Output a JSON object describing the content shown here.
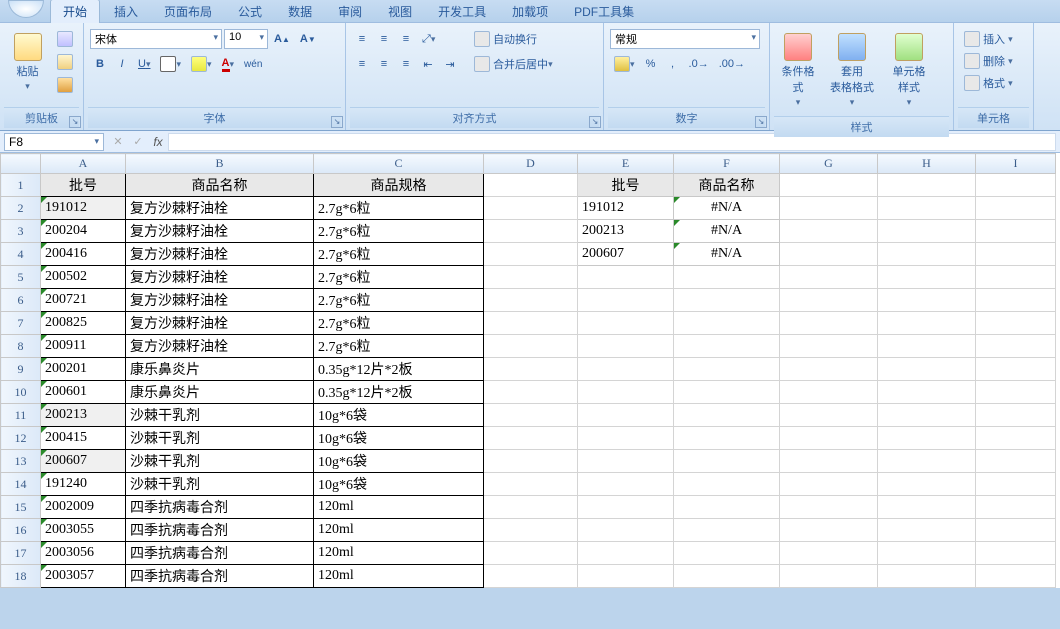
{
  "tabs": [
    "开始",
    "插入",
    "页面布局",
    "公式",
    "数据",
    "审阅",
    "视图",
    "开发工具",
    "加载项",
    "PDF工具集"
  ],
  "activeTabIndex": 0,
  "clipboard": {
    "label": "剪贴板",
    "paste": "粘贴"
  },
  "font": {
    "label": "字体",
    "family": "宋体",
    "size": "10",
    "bold": "B",
    "italic": "I",
    "underline": "U"
  },
  "alignment": {
    "label": "对齐方式",
    "wrap": "自动换行",
    "merge": "合并后居中"
  },
  "number": {
    "label": "数字",
    "format": "常规",
    "pct": "%",
    "comma": ","
  },
  "styles": {
    "label": "样式",
    "cond": "条件格式",
    "table": "套用\n表格格式",
    "cell": "单元格\n样式"
  },
  "cells": {
    "label": "单元格",
    "insert": "插入",
    "delete": "删除",
    "format": "格式"
  },
  "namebox": "F8",
  "cols": [
    "A",
    "B",
    "C",
    "D",
    "E",
    "F",
    "G",
    "H",
    "I"
  ],
  "leftHeaders": [
    "批号",
    "商品名称",
    "商品规格"
  ],
  "rightHeaders": [
    "批号",
    "商品名称"
  ],
  "rows": [
    {
      "n": 1,
      "A": "批号",
      "B": "商品名称",
      "C": "商品规格",
      "E": "批号",
      "F": "商品名称",
      "hdr": true,
      "rhdr": true
    },
    {
      "n": 2,
      "A": "191012",
      "B": "复方沙棘籽油栓",
      "C": "2.7g*6粒",
      "E": "191012",
      "F": "#N/A",
      "shadeA": true,
      "errF": true
    },
    {
      "n": 3,
      "A": "200204",
      "B": "复方沙棘籽油栓",
      "C": "2.7g*6粒",
      "E": "200213",
      "F": "#N/A",
      "errF": true
    },
    {
      "n": 4,
      "A": "200416",
      "B": "复方沙棘籽油栓",
      "C": "2.7g*6粒",
      "E": "200607",
      "F": "#N/A",
      "errF": true
    },
    {
      "n": 5,
      "A": "200502",
      "B": "复方沙棘籽油栓",
      "C": "2.7g*6粒"
    },
    {
      "n": 6,
      "A": "200721",
      "B": "复方沙棘籽油栓",
      "C": "2.7g*6粒"
    },
    {
      "n": 7,
      "A": "200825",
      "B": "复方沙棘籽油栓",
      "C": "2.7g*6粒"
    },
    {
      "n": 8,
      "A": "200911",
      "B": "复方沙棘籽油栓",
      "C": "2.7g*6粒"
    },
    {
      "n": 9,
      "A": "200201",
      "B": "康乐鼻炎片",
      "C": "0.35g*12片*2板"
    },
    {
      "n": 10,
      "A": "200601",
      "B": "康乐鼻炎片",
      "C": "0.35g*12片*2板"
    },
    {
      "n": 11,
      "A": "200213",
      "B": "沙棘干乳剂",
      "C": "10g*6袋",
      "shadeA": true
    },
    {
      "n": 12,
      "A": "200415",
      "B": "沙棘干乳剂",
      "C": "10g*6袋"
    },
    {
      "n": 13,
      "A": "200607",
      "B": "沙棘干乳剂",
      "C": "10g*6袋",
      "shadeA": true
    },
    {
      "n": 14,
      "A": "191240",
      "B": "沙棘干乳剂",
      "C": "10g*6袋"
    },
    {
      "n": 15,
      "A": "2002009",
      "B": "四季抗病毒合剂",
      "C": "120ml"
    },
    {
      "n": 16,
      "A": "2003055",
      "B": "四季抗病毒合剂",
      "C": "120ml"
    },
    {
      "n": 17,
      "A": "2003056",
      "B": "四季抗病毒合剂",
      "C": "120ml"
    },
    {
      "n": 18,
      "A": "2003057",
      "B": "四季抗病毒合剂",
      "C": "120ml"
    }
  ]
}
